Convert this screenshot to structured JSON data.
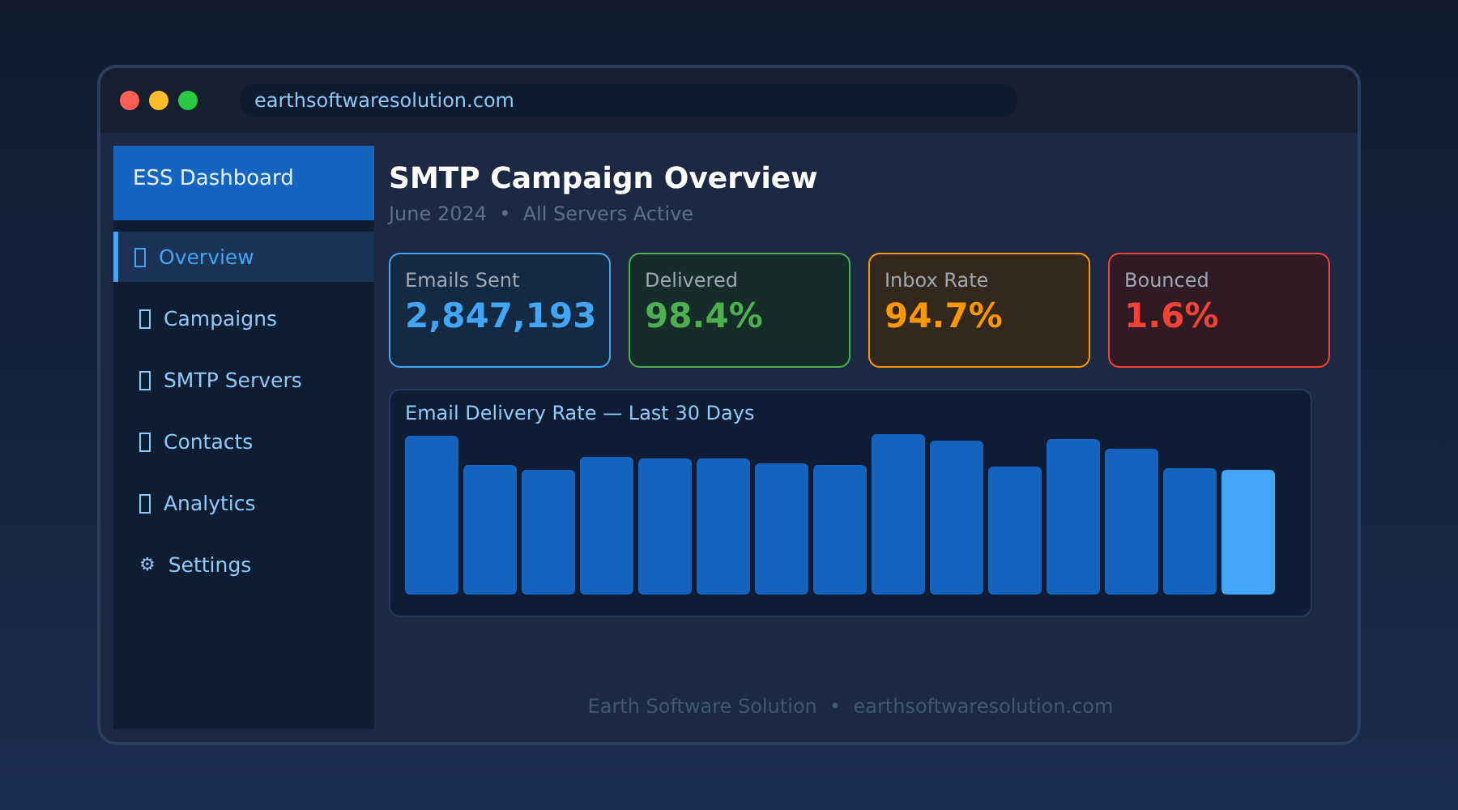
{
  "browser": {
    "url": "earthsoftwaresolution.com"
  },
  "sidebar": {
    "title": "ESS Dashboard",
    "items": [
      {
        "label": "Overview",
        "kind": "box",
        "selected": true
      },
      {
        "label": "Campaigns",
        "kind": "box",
        "selected": false
      },
      {
        "label": "SMTP Servers",
        "kind": "box",
        "selected": false
      },
      {
        "label": "Contacts",
        "kind": "box",
        "selected": false
      },
      {
        "label": "Analytics",
        "kind": "box",
        "selected": false
      },
      {
        "label": "Settings",
        "kind": "symbol",
        "icon": "⚙",
        "selected": false
      }
    ]
  },
  "header": {
    "title": "SMTP Campaign Overview",
    "subtitle": "June 2024  •  All Servers Active"
  },
  "stats": [
    {
      "label": "Emails Sent",
      "value": "2,847,193",
      "color": "#42a5f5"
    },
    {
      "label": "Delivered",
      "value": "98.4%",
      "color": "#4caf50"
    },
    {
      "label": "Inbox Rate",
      "value": "94.7%",
      "color": "#ff9800"
    },
    {
      "label": "Bounced",
      "value": "1.6%",
      "color": "#f44336"
    }
  ],
  "chart": {
    "title": "Email Delivery Rate — Last 30 Days"
  },
  "footer": "Earth Software Solution  •  earthsoftwaresolution.com"
}
